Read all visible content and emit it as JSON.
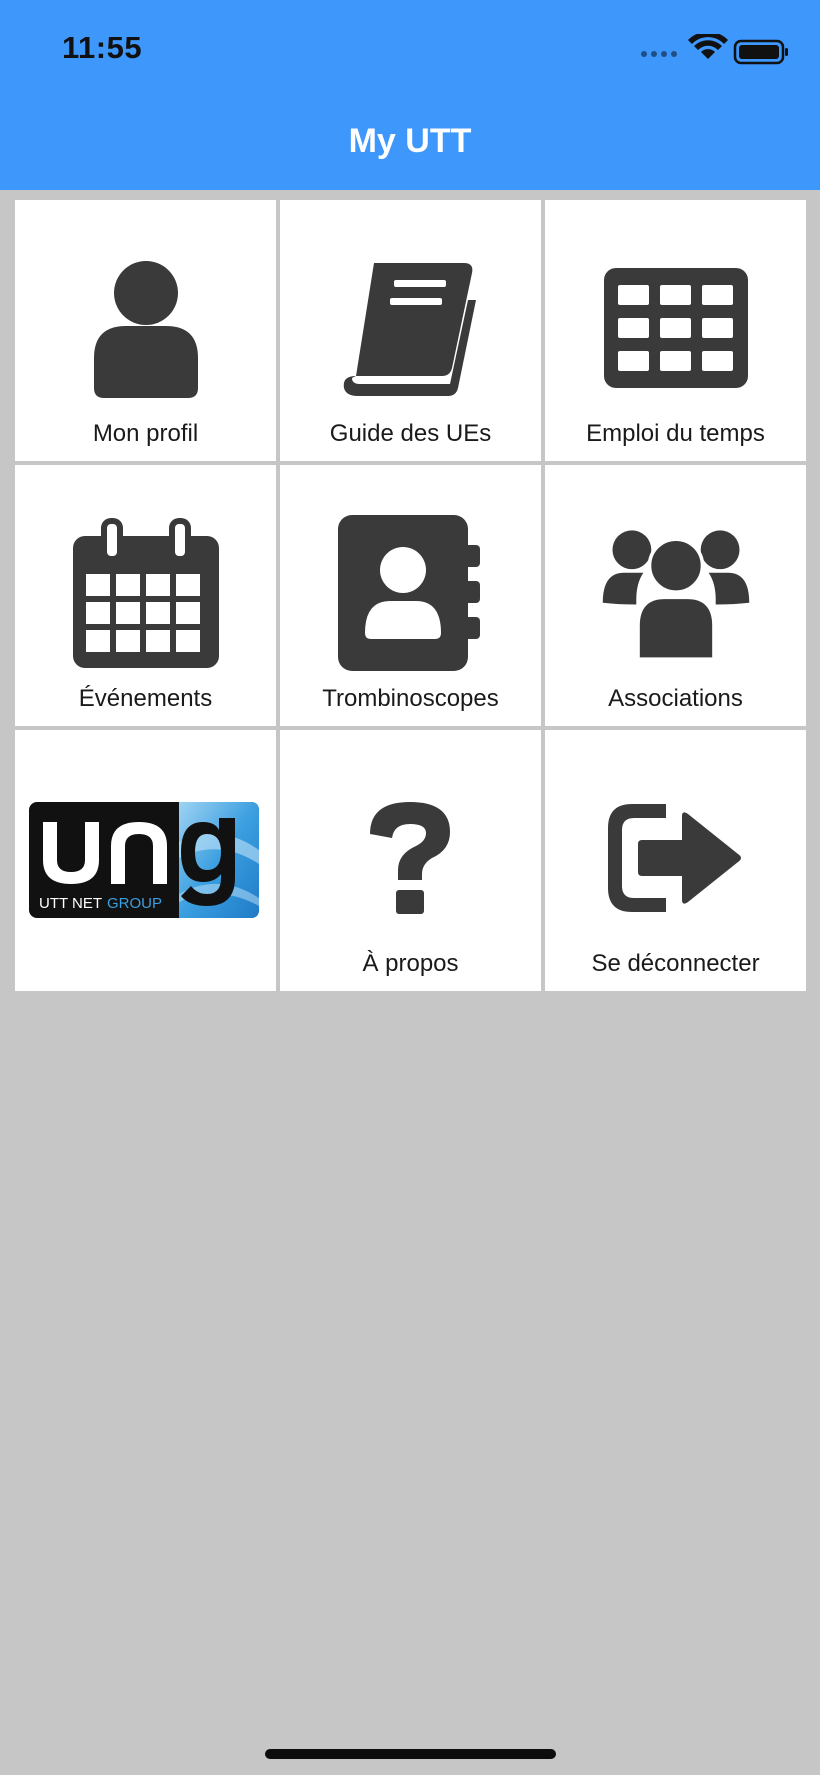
{
  "status_bar": {
    "time": "11:55",
    "icons": [
      "signal-dots-icon",
      "wifi-icon",
      "battery-icon"
    ]
  },
  "nav": {
    "title": "My UTT"
  },
  "colors": {
    "header": "#3e97fb",
    "background": "#c6c6c6",
    "tile": "#ffffff",
    "icon": "#3a3a3a"
  },
  "menu": {
    "items": [
      {
        "label": "Mon profil",
        "icon": "user-icon"
      },
      {
        "label": "Guide des UEs",
        "icon": "book-icon"
      },
      {
        "label": "Emploi du temps",
        "icon": "table-grid-icon"
      },
      {
        "label": "Événements",
        "icon": "calendar-icon"
      },
      {
        "label": "Trombinoscopes",
        "icon": "address-book-icon"
      },
      {
        "label": "Associations",
        "icon": "group-icon"
      },
      {
        "label": "",
        "icon": "ung-logo",
        "logo_text": "ung",
        "logo_caption_1": "UTT NET",
        "logo_caption_2": "GROUP"
      },
      {
        "label": "À propos",
        "icon": "question-icon"
      },
      {
        "label": "Se déconnecter",
        "icon": "sign-out-icon"
      }
    ]
  }
}
